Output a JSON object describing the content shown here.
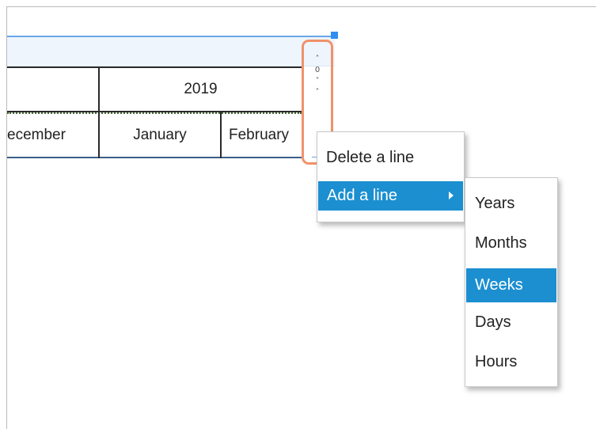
{
  "header": {
    "handle_glyph": "."
  },
  "timeline": {
    "year_label": "2019",
    "months": [
      "ecember",
      "January",
      "February"
    ]
  },
  "grip": {
    "glyphs": [
      "˄",
      "0",
      "˅",
      "˄"
    ]
  },
  "context_menu": {
    "items": [
      {
        "label": "Delete a line",
        "selected": false
      },
      {
        "label": "Add a line",
        "selected": true,
        "has_submenu": true
      }
    ]
  },
  "submenu": {
    "items": [
      {
        "label": "Years",
        "selected": false
      },
      {
        "label": "Months",
        "selected": false
      },
      {
        "label": "Weeks",
        "selected": true
      },
      {
        "label": "Days",
        "selected": false
      },
      {
        "label": "Hours",
        "selected": false
      }
    ]
  },
  "colors": {
    "selection": "#1b8fd0",
    "highlight_border": "#f0926b",
    "handle": "#2f8ff0"
  }
}
